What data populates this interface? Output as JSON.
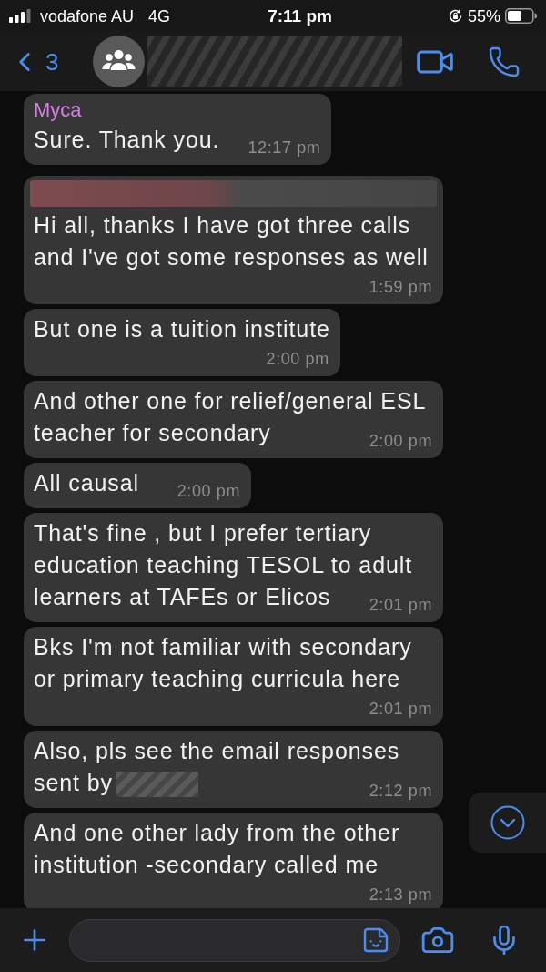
{
  "status_bar": {
    "carrier": "vodafone AU",
    "network": "4G",
    "time": "7:11 pm",
    "battery": "55%"
  },
  "header": {
    "back_count": "3",
    "title_blurred": true
  },
  "messages": [
    {
      "kind": "inline",
      "sender": {
        "name": "Myca",
        "color": "#d77fe8"
      },
      "sender_blurred": false,
      "lines": [
        "Sure. Thank you."
      ],
      "trailing_blur": false,
      "time": "12:17 pm"
    },
    {
      "kind": "stacked",
      "sender_blurred": true,
      "lines": [
        "Hi all, thanks I have got three calls",
        "and I've got some responses as well"
      ],
      "trailing_blur": false,
      "time": "1:59 pm"
    },
    {
      "kind": "stacked",
      "sender_blurred": false,
      "lines": [
        "But one is a tuition institute"
      ],
      "trailing_blur": false,
      "time": "2:00 pm"
    },
    {
      "kind": "inline",
      "sender_blurred": false,
      "lines": [
        "And other one for relief/general ESL",
        "teacher for secondary"
      ],
      "trailing_blur": false,
      "time": "2:00 pm"
    },
    {
      "kind": "inline",
      "sender_blurred": false,
      "lines": [
        "All causal"
      ],
      "trailing_blur": false,
      "time": "2:00 pm"
    },
    {
      "kind": "inline",
      "sender_blurred": false,
      "lines": [
        "That's fine , but I prefer tertiary",
        "education teaching TESOL to adult",
        "learners at TAFEs or Elicos"
      ],
      "trailing_blur": false,
      "time": "2:01 pm"
    },
    {
      "kind": "stacked",
      "sender_blurred": false,
      "lines": [
        "Bks I'm not familiar with secondary",
        "or primary teaching curricula here"
      ],
      "trailing_blur": false,
      "time": "2:01 pm"
    },
    {
      "kind": "inline",
      "sender_blurred": false,
      "lines": [
        "Also, pls see the email responses",
        "sent by"
      ],
      "trailing_blur": true,
      "time": "2:12 pm"
    },
    {
      "kind": "stacked",
      "sender_blurred": false,
      "lines": [
        "And one other lady from the other",
        "institution -secondary called me"
      ],
      "trailing_blur": false,
      "time": "2:13 pm"
    }
  ]
}
